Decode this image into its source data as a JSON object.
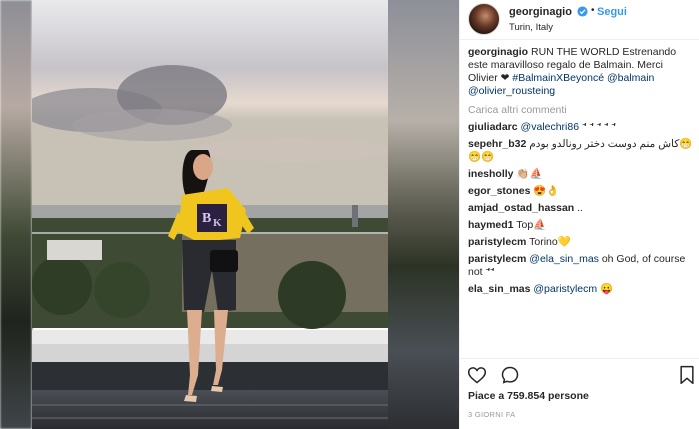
{
  "post": {
    "username": "georginagio",
    "follow_label": "Segui",
    "separator": "•",
    "location": "Turin, Italy",
    "caption_username": "georginagio",
    "caption_text": " RUN THE WORLD Estrenando este maravilloso regalo de Balmain. Merci Olivier ❤",
    "hashtag": "#BalmainXBeyoncé",
    "mention_balmain": "@balmain",
    "mention_olivier": "@olivier_rousteing",
    "load_more_label": "Carica altri commenti",
    "likes_label": "Piace a 759.854 persone",
    "time_label": "3 GIORNI FA"
  },
  "comments": [
    {
      "user": "giuliadarc",
      "mention": "@valechri86",
      "text": " 𝀀 𝀀 𝀀 𝀀 𝀀"
    },
    {
      "user": "sepehr_b32",
      "mention": "",
      "text": " کاش منم دوست دختر رونالدو بودم😁😁😁"
    },
    {
      "user": "inesholly",
      "mention": "",
      "text": " 👏🏼⛵"
    },
    {
      "user": "egor_stones",
      "mention": "",
      "text": " 😍👌"
    },
    {
      "user": "amjad_ostad_hassan",
      "mention": "",
      "text": " .."
    },
    {
      "user": "haymed1",
      "mention": "",
      "text": " Top⛵"
    },
    {
      "user": "paristylecm",
      "mention": "",
      "text": " Torino💛"
    },
    {
      "user": "paristylecm",
      "mention": "@ela_sin_mas",
      "text": " oh God, of course not 𝀀𝀀"
    },
    {
      "user": "ela_sin_mas",
      "mention": "@paristylecm",
      "text": " 😛"
    }
  ],
  "icons": {
    "heart": "heart-icon",
    "comment": "comment-icon",
    "bookmark": "bookmark-icon",
    "verified": "verified-badge-icon"
  },
  "colors": {
    "link_blue": "#3897f0",
    "tag_blue": "#003569",
    "muted": "#999999",
    "text": "#262626"
  }
}
